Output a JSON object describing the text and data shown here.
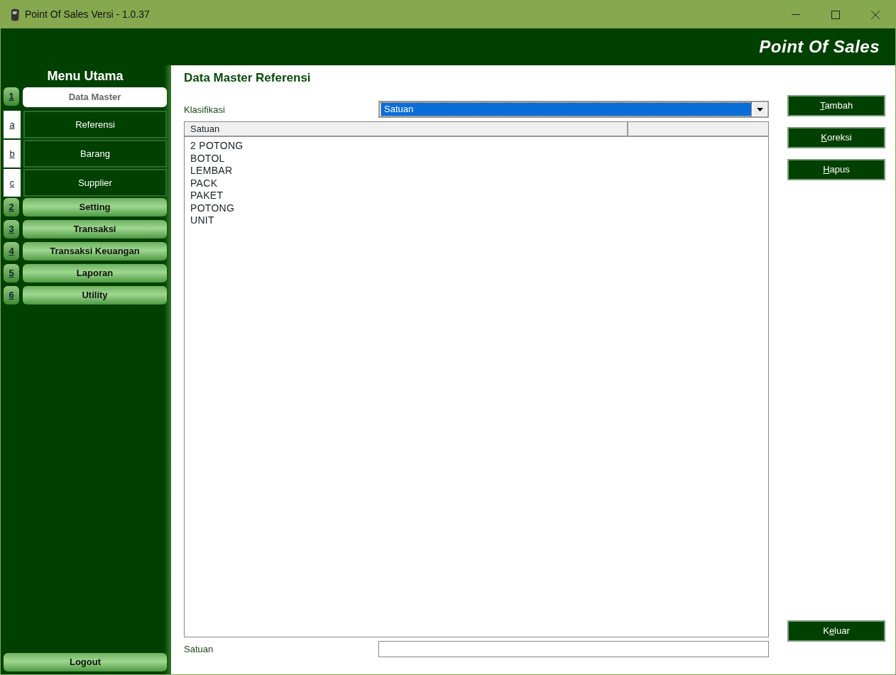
{
  "window": {
    "title": "Point Of Sales Versi - 1.0.37"
  },
  "header": {
    "title": "Point Of Sales"
  },
  "sidebar": {
    "title": "Menu Utama",
    "sections": [
      {
        "key": "1",
        "label": "Data Master",
        "selected": true,
        "children": [
          {
            "key": "a",
            "label": "Referensi"
          },
          {
            "key": "b",
            "label": "Barang"
          },
          {
            "key": "c",
            "label": "Supplier"
          }
        ]
      },
      {
        "key": "2",
        "label": "Setting",
        "selected": false
      },
      {
        "key": "3",
        "label": "Transaksi",
        "selected": false
      },
      {
        "key": "4",
        "label": "Transaksi Keuangan",
        "selected": false
      },
      {
        "key": "5",
        "label": "Laporan",
        "selected": false
      },
      {
        "key": "6",
        "label": "Utility",
        "selected": false
      }
    ],
    "logout": "Logout"
  },
  "content": {
    "title": "Data Master Referensi",
    "filter": {
      "label": "Klasifikasi",
      "value": "Satuan"
    },
    "table": {
      "columns": [
        "Satuan"
      ],
      "rows": [
        "2 POTONG",
        "BOTOL",
        "LEMBAR",
        "PACK",
        "PAKET",
        "POTONG",
        "UNIT"
      ]
    },
    "input": {
      "label": "Satuan"
    },
    "buttons": [
      {
        "key": "T",
        "post": "ambah"
      },
      {
        "key": "K",
        "post": "oreksi"
      },
      {
        "key": "H",
        "post": "apus"
      }
    ],
    "exit_button": {
      "pre": "K",
      "key": "e",
      "post": "luar"
    }
  }
}
